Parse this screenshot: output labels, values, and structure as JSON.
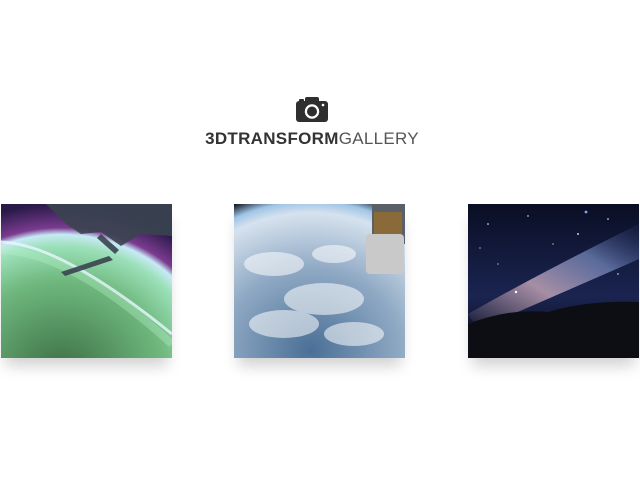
{
  "header": {
    "icon": "camera-icon",
    "title_bold": "3DTRANSFORM",
    "title_light": "GALLERY"
  },
  "gallery": {
    "items": [
      {
        "icon": "aurora-earth-photo",
        "description": "Aurora over Earth from space station"
      },
      {
        "icon": "earth-clouds-photo",
        "description": "Earth clouds from orbit with spacecraft"
      },
      {
        "icon": "milky-way-photo",
        "description": "Milky Way night sky over hills"
      }
    ]
  },
  "colors": {
    "title": "#333333",
    "background": "#ffffff"
  }
}
